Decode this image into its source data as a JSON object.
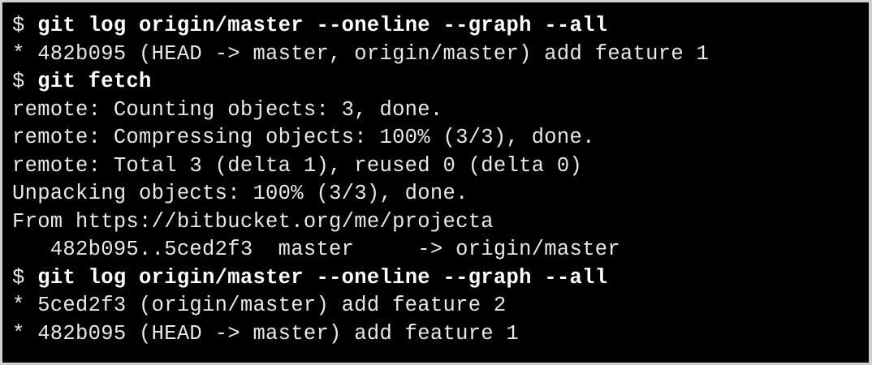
{
  "terminal": {
    "prompt_symbol": "$ ",
    "lines": [
      {
        "kind": "command",
        "text": "git log origin/master --oneline --graph --all"
      },
      {
        "kind": "output",
        "text": "* 482b095 (HEAD -> master, origin/master) add feature 1"
      },
      {
        "kind": "command",
        "text": "git fetch"
      },
      {
        "kind": "output",
        "text": "remote: Counting objects: 3, done."
      },
      {
        "kind": "output",
        "text": "remote: Compressing objects: 100% (3/3), done."
      },
      {
        "kind": "output",
        "text": "remote: Total 3 (delta 1), reused 0 (delta 0)"
      },
      {
        "kind": "output",
        "text": "Unpacking objects: 100% (3/3), done."
      },
      {
        "kind": "output",
        "text": "From https://bitbucket.org/me/projecta"
      },
      {
        "kind": "output",
        "text": "   482b095..5ced2f3  master     -> origin/master"
      },
      {
        "kind": "command",
        "text": "git log origin/master --oneline --graph --all"
      },
      {
        "kind": "output",
        "text": "* 5ced2f3 (origin/master) add feature 2"
      },
      {
        "kind": "output",
        "text": "* 482b095 (HEAD -> master) add feature 1"
      }
    ]
  }
}
